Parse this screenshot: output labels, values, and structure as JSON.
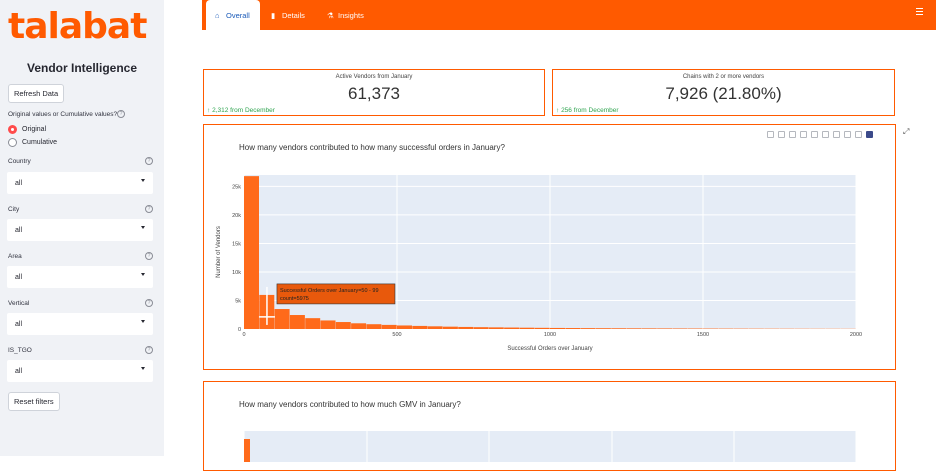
{
  "sidebar": {
    "logo": "talabat",
    "title": "Vendor Intelligence",
    "refresh_label": "Refresh Data",
    "values_question": "Original values or Cumulative values?",
    "radio_options": [
      "Original",
      "Cumulative"
    ],
    "filters": [
      {
        "label": "Country",
        "value": "all"
      },
      {
        "label": "City",
        "value": "all"
      },
      {
        "label": "Area",
        "value": "all"
      },
      {
        "label": "Vertical",
        "value": "all"
      },
      {
        "label": "IS_TGO",
        "value": "all"
      }
    ],
    "reset_label": "Reset filters"
  },
  "nav": {
    "tabs": [
      "Overall",
      "Details",
      "Insights"
    ],
    "active": "Overall"
  },
  "kpis": [
    {
      "label": "Active Vendors from January",
      "value": "61,373",
      "delta": "2,312 from December"
    },
    {
      "label": "Chains with 2 or more vendors",
      "value": "7,926 (21.80%)",
      "delta": "256 from December"
    }
  ],
  "colors": {
    "accent": "#ff5a00",
    "bar": "#ff6a1a",
    "delta": "#2ea44f",
    "link": "#1a5ab8"
  },
  "chart1": {
    "title": "How many vendors contributed to how many successful orders in January?",
    "hover_line1": "Successful Orders over January=50 - 99",
    "hover_line2": "count=5975"
  },
  "chart2": {
    "title": "How many vendors contributed to how much GMV in January?"
  },
  "chart_data": [
    {
      "type": "bar",
      "title": "How many vendors contributed to how many successful orders in January?",
      "xlabel": "Successful Orders over January",
      "ylabel": "Number of Vendors",
      "bin_width": 50,
      "xlim": [
        0,
        2000
      ],
      "ylim": [
        0,
        27000
      ],
      "xticks": [
        "0",
        "500",
        "1000",
        "1500",
        "2000"
      ],
      "yticks": [
        "0",
        "5k",
        "10k",
        "15k",
        "20k",
        "25k"
      ],
      "values": [
        26800,
        5975,
        3500,
        2450,
        1900,
        1500,
        1220,
        1000,
        840,
        720,
        620,
        540,
        470,
        410,
        360,
        320,
        285,
        255,
        228,
        205,
        185,
        168,
        152,
        138,
        126,
        115,
        105,
        96,
        88,
        81,
        74,
        68,
        62,
        57,
        52,
        48,
        44,
        40,
        37,
        34
      ],
      "grid": true
    },
    {
      "type": "bar",
      "title": "How many vendors contributed to how much GMV in January?",
      "values": [
        1
      ]
    }
  ]
}
